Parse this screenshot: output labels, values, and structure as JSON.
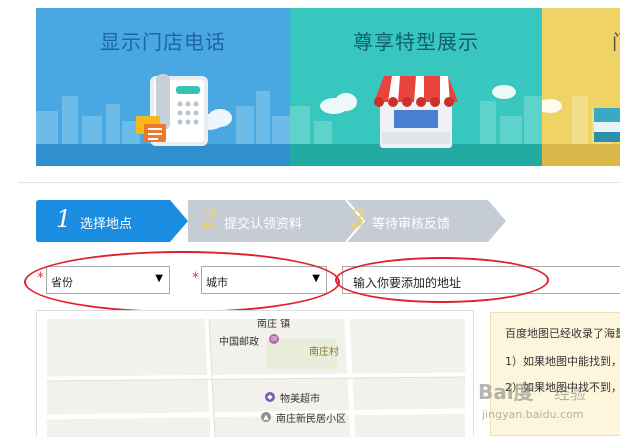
{
  "banner": {
    "panels": [
      {
        "title": "显示门店电话"
      },
      {
        "title": "尊享特型展示"
      },
      {
        "title": "门"
      }
    ]
  },
  "steps": [
    {
      "num": "1",
      "label": "选择地点",
      "active": true
    },
    {
      "num": "2",
      "label": "提交认领资料",
      "active": false
    },
    {
      "num": "3",
      "label": "等待审核反馈",
      "active": false
    }
  ],
  "form": {
    "required_mark": "*",
    "province": {
      "value": "省份"
    },
    "city": {
      "value": "城市"
    },
    "address": {
      "placeholder": "输入你要添加的地址"
    }
  },
  "map": {
    "labels": {
      "top": "南庄 镇",
      "post": "中国邮政",
      "village": "南庄村",
      "market": "物美超市",
      "community": "南庄新民居小区"
    }
  },
  "info": {
    "line1": "百度地图已经收录了海量",
    "line2": "1）如果地图中能找到，",
    "line3": "2）如果地图中找不到，"
  },
  "watermark": {
    "brand": "Bai度",
    "sub": "经验",
    "url": "jingyan.baidu.com"
  },
  "colors": {
    "step_active": "#1a8de0",
    "step_inactive": "#c6ccd3",
    "accent_red": "#e0202a"
  }
}
